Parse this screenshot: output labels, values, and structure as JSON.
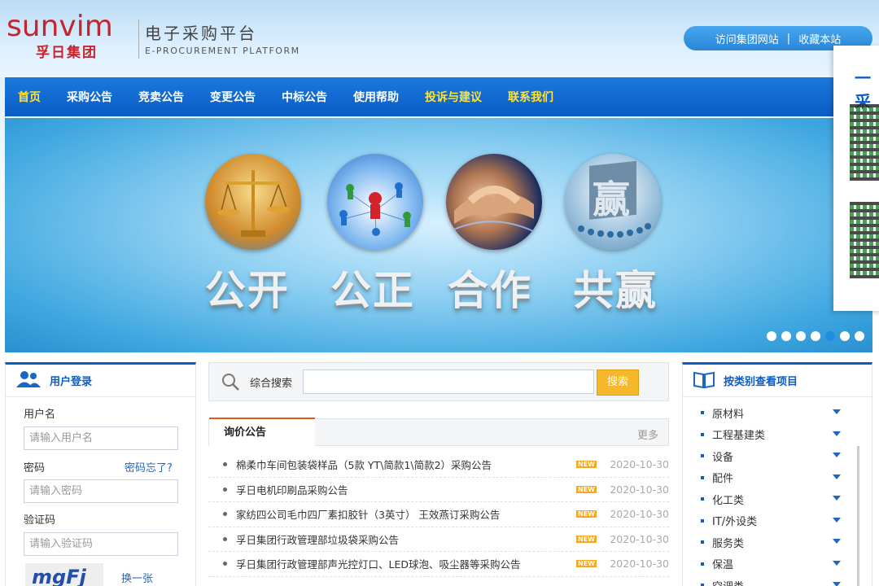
{
  "header": {
    "logo_word": "sunvim",
    "logo_cn": "孚日集团",
    "platform_cn": "电子采购平台",
    "platform_en": "E-PROCUREMENT PLATFORM",
    "links": [
      "访问集团网站",
      "|",
      "收藏本站"
    ]
  },
  "nav": [
    "首页",
    "采购公告",
    "竞卖公告",
    "变更公告",
    "中标公告",
    "使用帮助",
    "投诉与建议",
    "联系我们"
  ],
  "banner": {
    "slogans": [
      "公开",
      "公正",
      "合作",
      "共赢"
    ],
    "badge": "赢",
    "dots_total": 7,
    "dots_active": 5
  },
  "qr_panel": {
    "title": "一采"
  },
  "login": {
    "title": "用户登录",
    "username_label": "用户名",
    "username_placeholder": "请输入用户名",
    "password_label": "密码",
    "forgot": "密码忘了?",
    "password_placeholder": "请输入密码",
    "captcha_label": "验证码",
    "captcha_placeholder": "请输入验证码",
    "captcha_text": "mgFj",
    "refresh": "换一张"
  },
  "search": {
    "label": "综合搜索",
    "button": "搜索"
  },
  "announcements": {
    "tab": "询价公告",
    "more": "更多",
    "new_badge": "NEW",
    "rows": [
      {
        "title": "棉柔巾车间包装袋样品（5款 YT\\简款1\\简款2）采购公告",
        "date": "2020-10-30"
      },
      {
        "title": "孚日电机印刷品采购公告",
        "date": "2020-10-30"
      },
      {
        "title": "家纺四公司毛巾四厂素扣胶针（3英寸） 王效燕订采购公告",
        "date": "2020-10-30"
      },
      {
        "title": "孚日集团行政管理部垃圾袋采购公告",
        "date": "2020-10-30"
      },
      {
        "title": "孚日集团行政管理部声光控灯口、LED球泡、吸尘器等采购公告",
        "date": "2020-10-30"
      }
    ]
  },
  "categories": {
    "title": "按类别查看项目",
    "items": [
      "原材料",
      "工程基建类",
      "设备",
      "配件",
      "化工类",
      "IT/外设类",
      "服务类",
      "保温",
      "空调类"
    ]
  },
  "colors": {
    "brand_red": "#c4262e",
    "nav_blue": "#0b5cc3",
    "highlight_yellow": "#ffe338",
    "search_button": "#f6b82b"
  }
}
